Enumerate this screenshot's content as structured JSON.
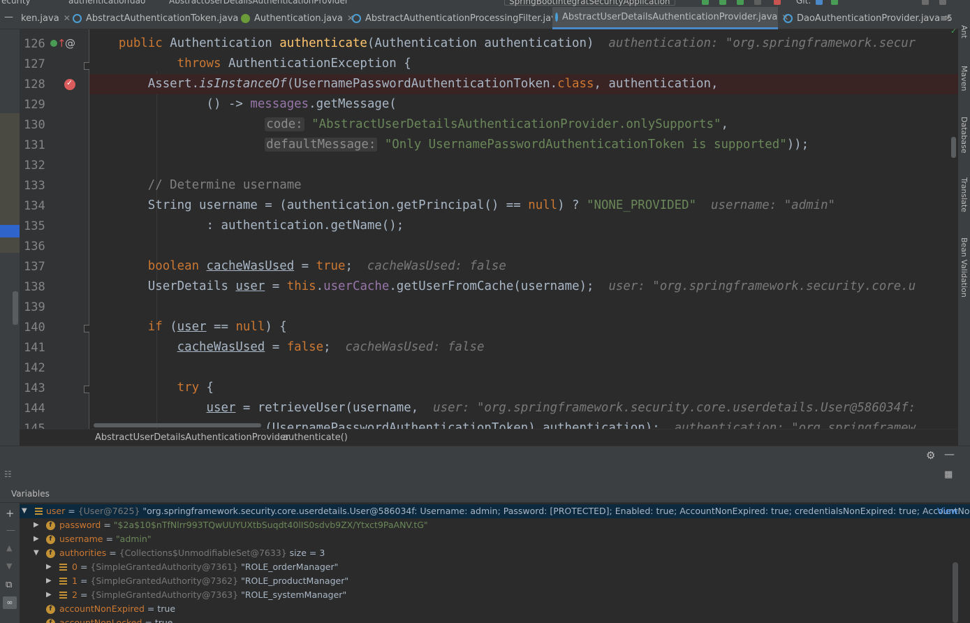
{
  "topbar": {
    "crumbs": [
      "ecurity",
      "authentication",
      "dao",
      "AbstractUserDetailsAuthenticationProvider"
    ],
    "run_config": "SpringBootIntegratSecurityApplication",
    "git_label": "Git:"
  },
  "tabs": [
    {
      "label": "ken.java",
      "icon": "class",
      "active": false
    },
    {
      "label": "AbstractAuthenticationToken.java",
      "icon": "class",
      "active": false
    },
    {
      "label": "Authentication.java",
      "icon": "interface",
      "active": false
    },
    {
      "label": "AbstractAuthenticationProcessingFilter.java",
      "icon": "class",
      "active": false
    },
    {
      "label": "AbstractUserDetailsAuthenticationProvider.java",
      "icon": "class",
      "active": true
    },
    {
      "label": "DaoAuthenticationProvider.java",
      "icon": "class",
      "active": false
    }
  ],
  "tabs_overflow": "≡5",
  "line_numbers": [
    "126",
    "127",
    "128",
    "129",
    "130",
    "131",
    "132",
    "133",
    "134",
    "135",
    "136",
    "137",
    "138",
    "139",
    "140",
    "141",
    "142",
    "143",
    "144",
    "145"
  ],
  "code": {
    "l126_hint": "authentication: \"org.springframework.secur",
    "l130_param": "code:",
    "l130_str": "\"AbstractUserDetailsAuthenticationProvider.onlySupports\"",
    "l131_param": "defaultMessage:",
    "l131_str": "\"Only UsernamePasswordAuthenticationToken is supported\"",
    "l133_comment": "// Determine username",
    "l134_str": "\"NONE_PROVIDED\"",
    "l134_hint": "username: \"admin\"",
    "l137_hint": "cacheWasUsed: false",
    "l138_hint": "user: \"org.springframework.security.core.u",
    "l141_hint": "cacheWasUsed: false",
    "l144_hint": "user: \"org.springframework.security.core.userdetails.User@586034f:",
    "l145_hint": "authentication: \"org.springframew"
  },
  "right_tools": [
    "Ant",
    "Maven",
    "Database",
    "Translate",
    "Bean Validation"
  ],
  "editor_breadcrumb": [
    "AbstractUserDetailsAuthenticationProvider",
    "authenticate()"
  ],
  "variables_title": "Variables",
  "variables": {
    "user": {
      "name": "user",
      "type": "{User@7625}",
      "value": "\"org.springframework.security.core.userdetails.User@586034f: Username: admin; Password: [PROTECTED]; Enabled: true; AccountNonExpired: true; credentialsNonExpired: true; AccountNonLocked...",
      "view": "View"
    },
    "password": {
      "name": "password",
      "value": "\"$2a$10$nTfNlrr993TQwUUYUXtbSuqdt40lIS0sdvb9ZX/Ytxct9PaANV.tG\""
    },
    "username": {
      "name": "username",
      "value": "\"admin\""
    },
    "authorities": {
      "name": "authorities",
      "type": "{Collections$UnmodifiableSet@7633}",
      "size": "size = 3"
    },
    "auth_items": [
      {
        "idx": "0",
        "type": "{SimpleGrantedAuthority@7361}",
        "value": "\"ROLE_orderManager\""
      },
      {
        "idx": "1",
        "type": "{SimpleGrantedAuthority@7362}",
        "value": "\"ROLE_productManager\""
      },
      {
        "idx": "2",
        "type": "{SimpleGrantedAuthority@7363}",
        "value": "\"ROLE_systemManager\""
      }
    ],
    "accountNonExpired": {
      "name": "accountNonExpired",
      "value": "true"
    },
    "accountNonLocked": {
      "name": "accountNonLocked",
      "value": "true"
    }
  },
  "colors": {
    "keyword": "#cc7832",
    "method": "#ffc66d",
    "string": "#6a8759",
    "field": "#9876aa",
    "breakpoint": "#db5c5c",
    "active_tab_underline": "#4a88c7"
  }
}
